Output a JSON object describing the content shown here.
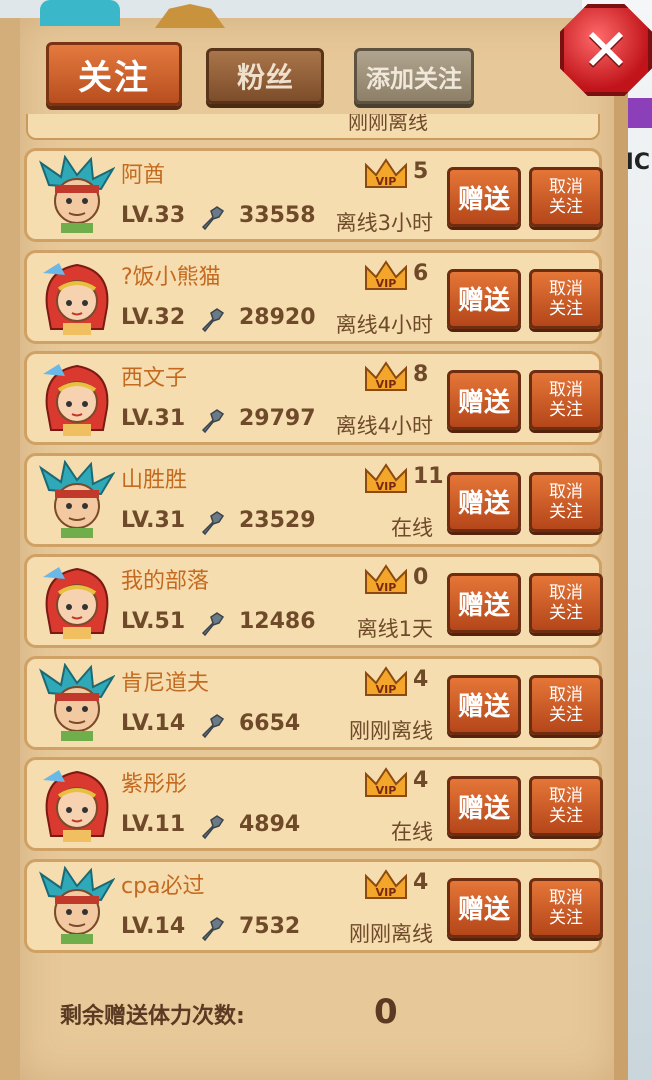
{
  "tabs": {
    "follow": "关注",
    "fans": "粉丝",
    "add_follow": "添加关注"
  },
  "bg_right_text": "IC",
  "partial_row_status": "刚刚离线",
  "buttons": {
    "gift": "赠送",
    "unfollow_line1": "取消",
    "unfollow_line2": "关注"
  },
  "friends": [
    {
      "name": "阿酋",
      "level": "LV.33",
      "power": "33558",
      "vip": "5",
      "status": "离线3小时",
      "avatar": "boy"
    },
    {
      "name": "?饭小熊猫",
      "level": "LV.32",
      "power": "28920",
      "vip": "6",
      "status": "离线4小时",
      "avatar": "girl"
    },
    {
      "name": "西文子",
      "level": "LV.31",
      "power": "29797",
      "vip": "8",
      "status": "离线4小时",
      "avatar": "girl"
    },
    {
      "name": "山胜胜",
      "level": "LV.31",
      "power": "23529",
      "vip": "11",
      "status": "在线",
      "avatar": "boy"
    },
    {
      "name": "我的部落",
      "level": "LV.51",
      "power": "12486",
      "vip": "0",
      "status": "离线1天",
      "avatar": "girl"
    },
    {
      "name": "肯尼道夫",
      "level": "LV.14",
      "power": "6654",
      "vip": "4",
      "status": "刚刚离线",
      "avatar": "boy"
    },
    {
      "name": "紫彤彤",
      "level": "LV.11",
      "power": "4894",
      "vip": "4",
      "status": "在线",
      "avatar": "girl"
    },
    {
      "name": "cpa必过",
      "level": "LV.14",
      "power": "7532",
      "vip": "4",
      "status": "刚刚离线",
      "avatar": "boy"
    }
  ],
  "footer": {
    "label": "剩余赠送体力次数:",
    "count": "0"
  },
  "colors": {
    "button_orange": "#e57638",
    "close_red": "#c0141a",
    "parchment": "#e7c899",
    "row_bg": "#f6ddaf"
  }
}
